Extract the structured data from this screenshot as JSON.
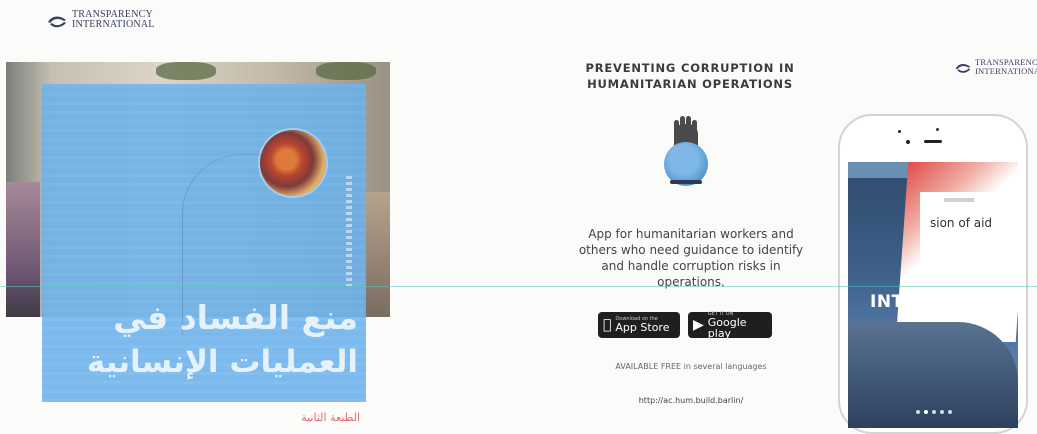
{
  "left_panel": {
    "logo": {
      "line1": "TRANSPARENCY",
      "line2": "INTERNATIONAL",
      "tagline": ""
    },
    "cover": {
      "arabic_title_line1": "منع الفساد في",
      "arabic_title_line2": "العمليات الإنسانية",
      "edition": "الطبعة الثانية",
      "colors": {
        "overlay": "#6ab0ec",
        "title": "#e6f2fb",
        "edition": "#e06a76"
      }
    }
  },
  "middle_panel": {
    "title": "PREVENTING CORRUPTION IN HUMANITARIAN OPERATIONS",
    "description": "App for humanitarian workers and others who need guidance to identify and handle corruption risks in operations.",
    "app_store": {
      "small": "Download on the",
      "big": "App Store"
    },
    "google_play": {
      "small": "GET IT ON",
      "big": "Google play"
    },
    "note": "AVAILABLE FREE in several languages",
    "url": "http://ac.hum.build.barlin/"
  },
  "right_panel": {
    "logo": {
      "line1": "TRANSPARENCY",
      "line2": "INTERNATIONAL",
      "tagline": ""
    },
    "phone_screen": {
      "close": "×",
      "page_text": "sion of aid",
      "intro": "INTRODUCTI",
      "dots": 5,
      "active_dot": 1
    }
  }
}
